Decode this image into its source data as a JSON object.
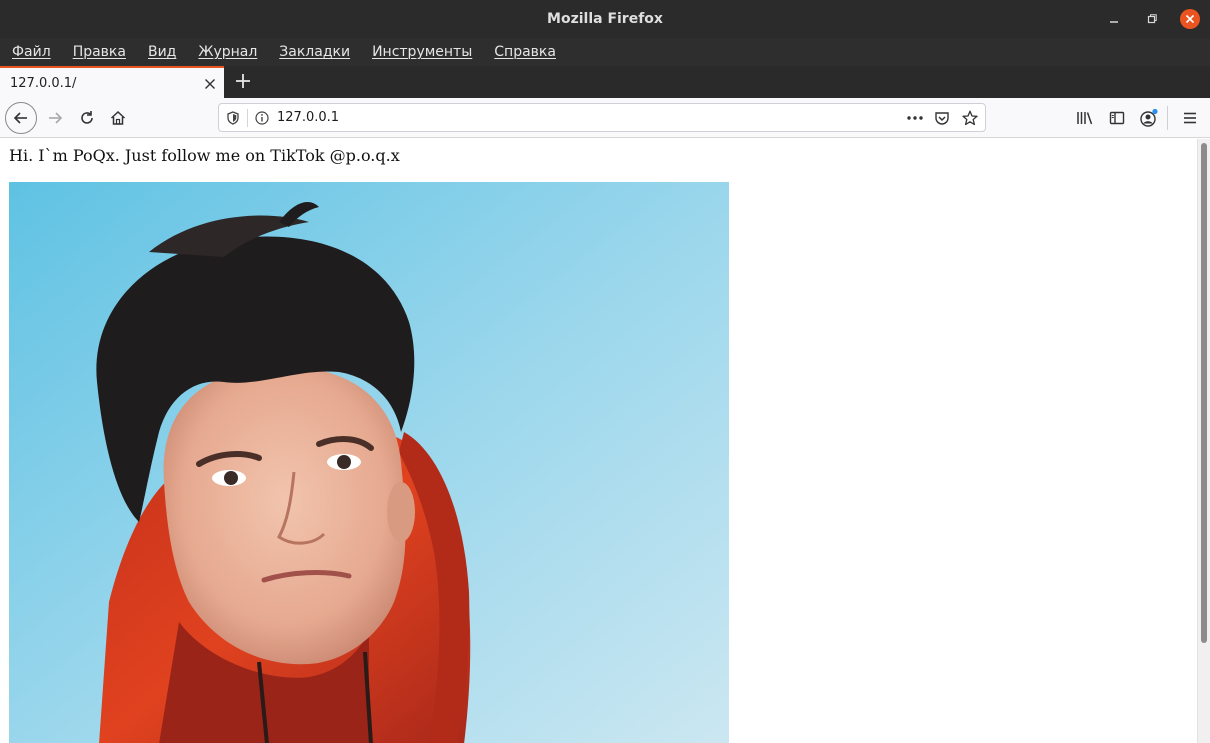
{
  "window": {
    "title": "Mozilla Firefox"
  },
  "menubar": {
    "items": [
      "Файл",
      "Правка",
      "Вид",
      "Журнал",
      "Закладки",
      "Инструменты",
      "Справка"
    ]
  },
  "tabs": [
    {
      "label": "127.0.0.1/",
      "active": true
    }
  ],
  "urlbar": {
    "value": "127.0.0.1"
  },
  "page": {
    "greeting": "Hi. I`m PoQx. Just follow me on TikTok @p.o.q.x"
  },
  "colors": {
    "accent": "#e95420",
    "titlebar": "#2b2b2b",
    "hoodie": "#d9341c",
    "sky": "#8fd3ea"
  }
}
